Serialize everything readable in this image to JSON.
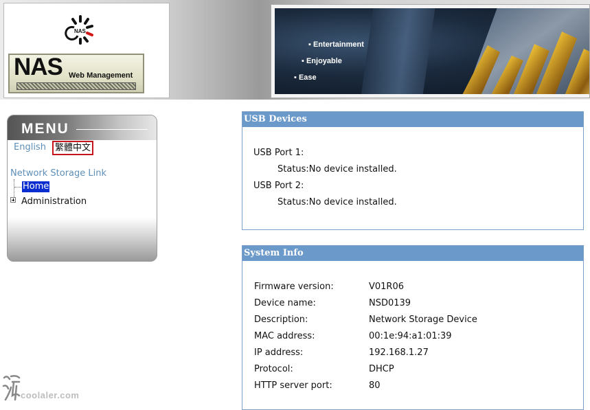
{
  "header": {
    "logo_symbol_text": "NAS",
    "logo_main_text": "NAS",
    "logo_sub_text": "Web Management",
    "banner_bullets": [
      "Entertainment",
      "Enjoyable",
      "Ease"
    ]
  },
  "menu": {
    "title": "MENU",
    "languages": [
      "English",
      "繁體中文"
    ],
    "tree": {
      "root": "Network Storage Link",
      "items": [
        {
          "label": "Home",
          "selected": true
        },
        {
          "label": "Administration",
          "expandable": true
        }
      ]
    }
  },
  "usb": {
    "title": "USB Devices",
    "ports": [
      {
        "name": "USB Port 1:",
        "status": "Status:No device installed."
      },
      {
        "name": "USB Port 2:",
        "status": "Status:No device installed."
      }
    ]
  },
  "system": {
    "title": "System Info",
    "rows": [
      {
        "label": "Firmware version:",
        "value": "V01R06"
      },
      {
        "label": "Device name:",
        "value": "NSD0139"
      },
      {
        "label": "Description:",
        "value": "Network Storage Device"
      },
      {
        "label": "MAC address:",
        "value": "00:1e:94:a1:01:39"
      },
      {
        "label": "IP address:",
        "value": "192.168.1.27"
      },
      {
        "label": "Protocol:",
        "value": "DHCP"
      },
      {
        "label": "HTTP server port:",
        "value": "80"
      }
    ]
  },
  "watermark": {
    "text": "coolaler.com"
  },
  "colors": {
    "panel_header": "#6b99c9",
    "panel_border": "#7aa0c8",
    "link": "#5e8fb8",
    "selected_bg": "#0a2dcf",
    "lang_highlight": "#c4151c"
  }
}
